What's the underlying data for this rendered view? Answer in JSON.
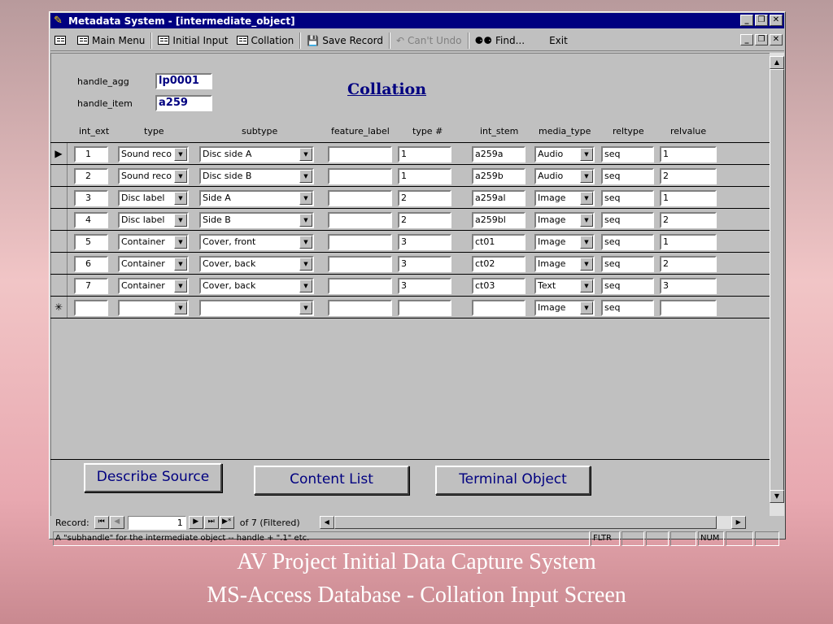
{
  "window": {
    "title": "Metadata System - [intermediate_object]"
  },
  "menubar": {
    "items": [
      "Main Menu",
      "Initial Input",
      "Collation",
      "Save Record",
      "Can't Undo",
      "Find...",
      "Exit"
    ]
  },
  "form": {
    "title": "Collation",
    "handle_agg_label": "handle_agg",
    "handle_agg_value": "lp0001",
    "handle_item_label": "handle_item",
    "handle_item_value": "a259",
    "columns": [
      "int_ext",
      "type",
      "subtype",
      "feature_label",
      "type #",
      "int_stem",
      "media_type",
      "reltype",
      "relvalue"
    ],
    "rows": [
      {
        "int_ext": "1",
        "type": "Sound reco",
        "subtype": "Disc side A",
        "feature_label": "",
        "type_num": "1",
        "int_stem": "a259a",
        "media_type": "Audio",
        "reltype": "seq",
        "relvalue": "1"
      },
      {
        "int_ext": "2",
        "type": "Sound reco",
        "subtype": "Disc side B",
        "feature_label": "",
        "type_num": "1",
        "int_stem": "a259b",
        "media_type": "Audio",
        "reltype": "seq",
        "relvalue": "2"
      },
      {
        "int_ext": "3",
        "type": "Disc label",
        "subtype": "Side A",
        "feature_label": "",
        "type_num": "2",
        "int_stem": "a259al",
        "media_type": "Image",
        "reltype": "seq",
        "relvalue": "1"
      },
      {
        "int_ext": "4",
        "type": "Disc label",
        "subtype": "Side B",
        "feature_label": "",
        "type_num": "2",
        "int_stem": "a259bl",
        "media_type": "Image",
        "reltype": "seq",
        "relvalue": "2"
      },
      {
        "int_ext": "5",
        "type": "Container",
        "subtype": "Cover, front",
        "feature_label": "",
        "type_num": "3",
        "int_stem": "ct01",
        "media_type": "Image",
        "reltype": "seq",
        "relvalue": "1"
      },
      {
        "int_ext": "6",
        "type": "Container",
        "subtype": "Cover, back",
        "feature_label": "",
        "type_num": "3",
        "int_stem": "ct02",
        "media_type": "Image",
        "reltype": "seq",
        "relvalue": "2"
      },
      {
        "int_ext": "7",
        "type": "Container",
        "subtype": "Cover, back",
        "feature_label": "",
        "type_num": "3",
        "int_stem": "ct03",
        "media_type": "Text",
        "reltype": "seq",
        "relvalue": "3"
      }
    ],
    "new_row": {
      "media_type": "Image",
      "reltype": "seq"
    },
    "buttons": {
      "describe_source": "Describe Source",
      "content_list": "Content List",
      "terminal_object": "Terminal Object"
    }
  },
  "navigation": {
    "record_label": "Record:",
    "current": "1",
    "of_text": "of  7 (Filtered)"
  },
  "status": {
    "message": "A \"subhandle\" for the intermediate object -- handle + \".1\" etc.",
    "fltr": "FLTR",
    "num": "NUM"
  },
  "caption": {
    "line1": "AV Project Initial Data Capture System",
    "line2": "MS-Access Database - Collation Input Screen"
  },
  "icons": {
    "app": "key-icon",
    "form": "form-icon",
    "save": "save-icon",
    "undo": "undo-icon",
    "find": "binoculars-icon"
  }
}
